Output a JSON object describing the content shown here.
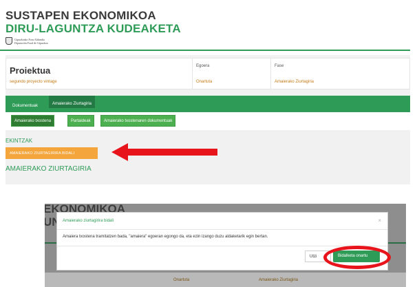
{
  "header": {
    "line1": "SUSTAPEN EKONOMIKOA",
    "line2": "DIRU-LAGUNTZA KUDEAKETA",
    "logo_line1": "Gipuzkoako Foru Aldundia",
    "logo_line2": "Diputación Foral de Gipuzkoa"
  },
  "project": {
    "title": "Proiektua",
    "subtitle": "segundo proyecto vintage",
    "status_label": "Egoera",
    "status_value": "Onartuta",
    "phase_label": "Fase",
    "phase_value": "Amaierako Ziurtagiria"
  },
  "tabs": [
    {
      "label": "Dokumentuak",
      "active": false
    },
    {
      "label": "Amaierako Ziurtagiria",
      "active": true
    }
  ],
  "subtabs": [
    {
      "label": "Amaierako txostena"
    },
    {
      "label": "Partaideak"
    },
    {
      "label": "Amaierako txostenaren dokumentuak"
    }
  ],
  "actions": {
    "section_label": "EKINTZAK",
    "send_button": "AMAIERAKO ZIURTAGIRIRA BIDALI",
    "certificate_heading": "AMAIERAKO ZIURTAGIRIA"
  },
  "background_page": {
    "line1": "EKONOMIKOA",
    "line2": "UNT",
    "status_value": "Onartuta",
    "phase_value": "Amaierako Ziurtagiria"
  },
  "modal": {
    "title": "Amaierako ziurtagirira bidali",
    "close": "×",
    "body": "Amaiera txostena tramitatzen bada, \"amaiera\" egoeran egongo da, eta ezin izango duzu aldaketarik egin bertan.",
    "cancel_label": "Utzi",
    "confirm_label": "Bidalketa onartu"
  },
  "colors": {
    "brand_green": "#2e9b57",
    "accent_orange": "#f4a53c",
    "annotation_red": "#e8141b"
  }
}
